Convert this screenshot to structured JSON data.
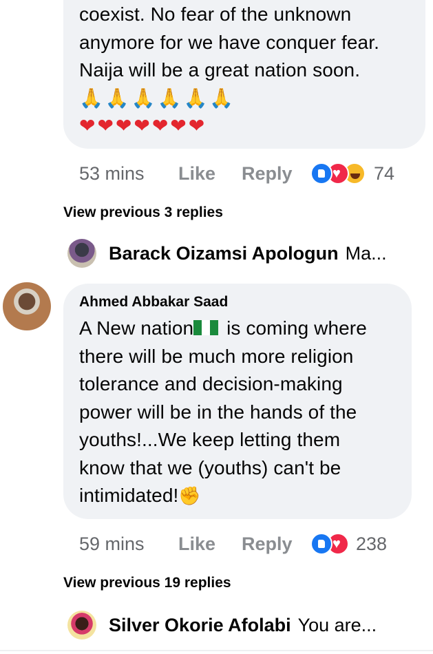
{
  "comment1": {
    "text_lines": [
      "coexist. No fear of the unknown",
      "anymore for we have conquer fear.",
      "Naija will be a great nation soon."
    ],
    "emoji_pray": "🙏🙏🙏🙏🙏🙏",
    "emoji_hearts": "❤❤❤❤❤❤❤",
    "time": "53 mins",
    "like_label": "Like",
    "reply_label": "Reply",
    "reactions": [
      "like",
      "love",
      "haha"
    ],
    "reaction_count": "74"
  },
  "view_prev_1": "View previous 3 replies",
  "collapsed_reply_1": {
    "name": "Barack Oizamsi Apologun",
    "preview": "Ma..."
  },
  "comment2": {
    "author": "Ahmed Abbakar Saad",
    "line1_a": "A New nation",
    "line1_b": " is coming where",
    "text_lines": [
      "there will be much more religion",
      "tolerance and decision-making",
      "power will be in the hands of the",
      "youths!...We keep letting them",
      "know that we (youths) can't be"
    ],
    "last_line": "intimidated!",
    "emoji_fist": "✊",
    "time": "59 mins",
    "like_label": "Like",
    "reply_label": "Reply",
    "reactions": [
      "like",
      "love"
    ],
    "reaction_count": "238"
  },
  "view_prev_2": "View previous 19 replies",
  "collapsed_reply_2": {
    "name": "Silver Okorie Afolabi",
    "preview": "You are..."
  },
  "colors": {
    "bubble": "#f0f2f5",
    "meta_text": "#65676b",
    "like_blue": "#1877f2",
    "love_red": "#f02849",
    "haha_yellow": "#f7b928",
    "nigeria_green": "#1a8a3c"
  }
}
